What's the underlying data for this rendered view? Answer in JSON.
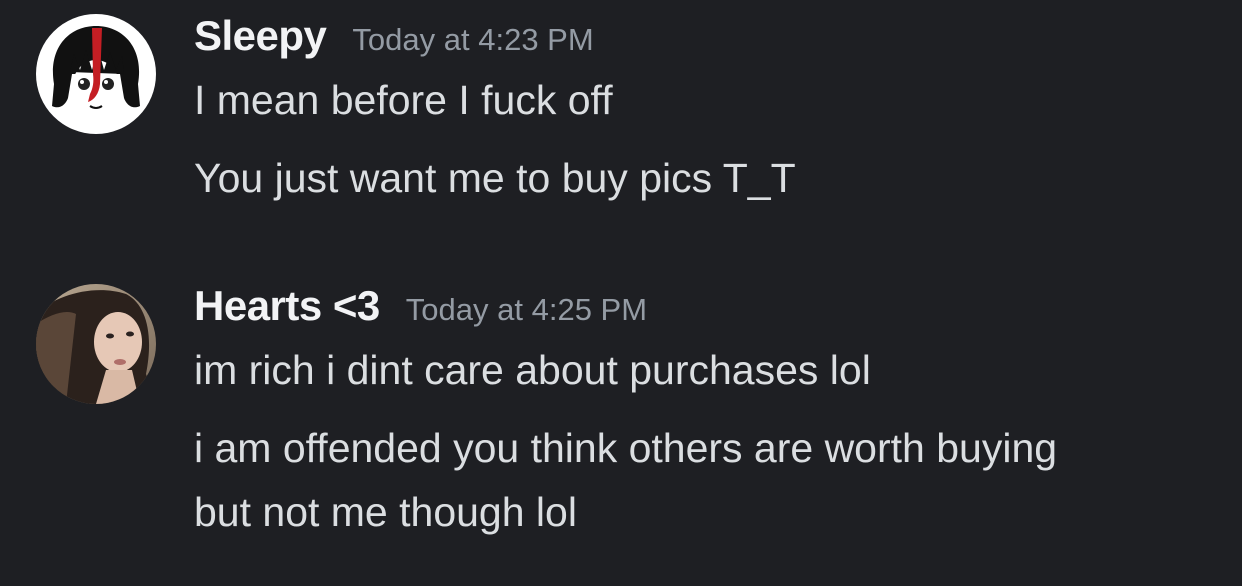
{
  "chat": {
    "messages": [
      {
        "username": "Sleepy",
        "timestamp": "Today at 4:23 PM",
        "avatar": "anime-girl-black-white-red-avatar",
        "lines": [
          "I mean before I fuck off",
          "You just want me to buy pics T_T"
        ]
      },
      {
        "username": "Hearts <3",
        "timestamp": "Today at 4:25 PM",
        "avatar": "woman-dark-hair-photo-avatar",
        "lines": [
          "im rich i dint care about purchases lol",
          "i am offended you think others are worth buying",
          "but not me though lol"
        ]
      }
    ]
  },
  "colors": {
    "background": "#1e1f23",
    "username": "#f2f3f5",
    "timestamp": "#949ba4",
    "message_text": "#dbdee1"
  }
}
